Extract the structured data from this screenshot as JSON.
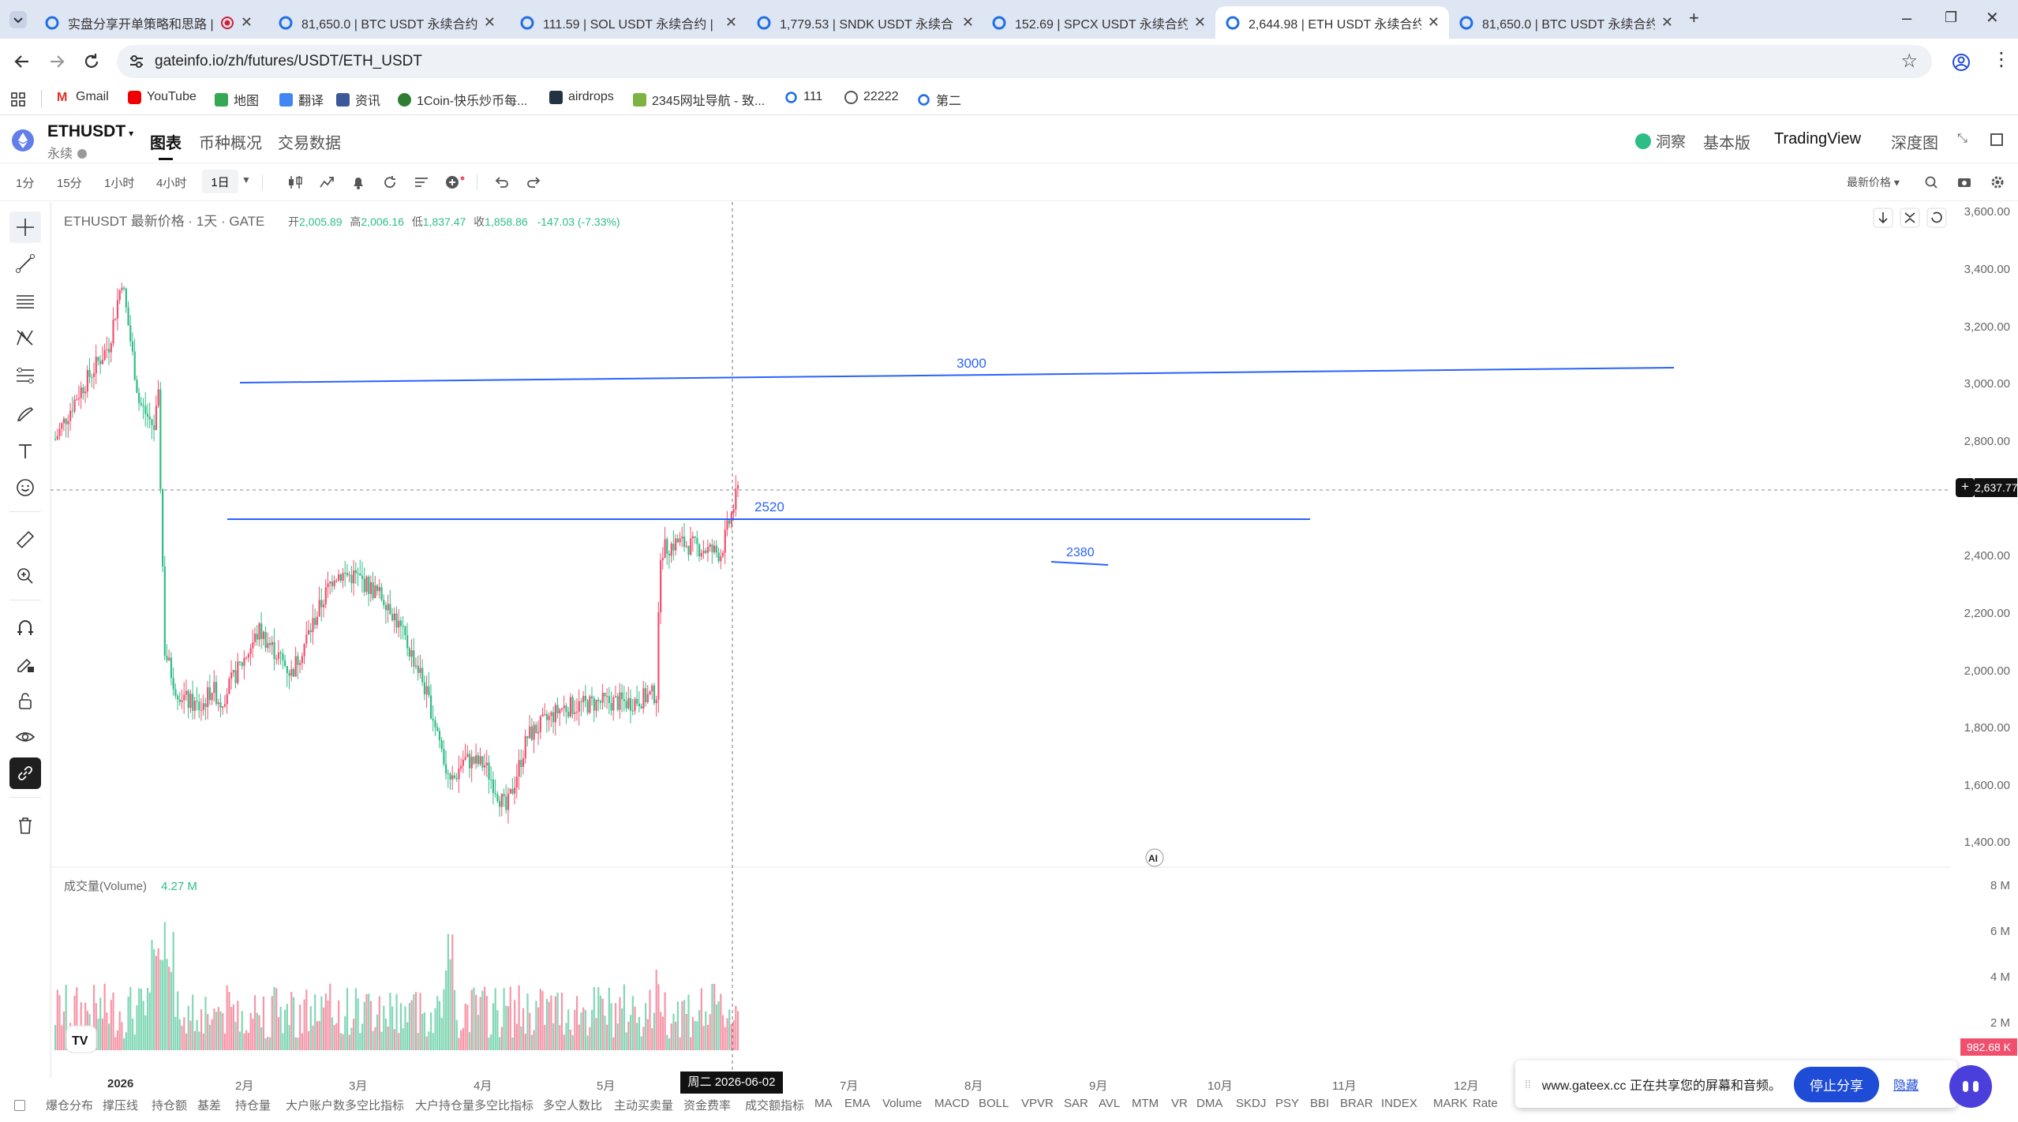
{
  "browser": {
    "tabs": [
      {
        "title": "实盘分享开单策略和思路 |",
        "active": false
      },
      {
        "title": "81,650.0 | BTC USDT 永续合约",
        "active": false
      },
      {
        "title": "111.59 | SOL USDT 永续合约 |",
        "active": false
      },
      {
        "title": "1,779.53 | SNDK USDT 永续合",
        "active": false
      },
      {
        "title": "152.69 | SPCX USDT 永续合约",
        "active": false
      },
      {
        "title": "2,644.98 | ETH USDT 永续合约",
        "active": true
      },
      {
        "title": "81,650.0 | BTC USDT 永续合约",
        "active": false
      }
    ],
    "url": "gateinfo.io/zh/futures/USDT/ETH_USDT",
    "bookmarks": [
      "Gmail",
      "YouTube",
      "地图",
      "翻译",
      "资讯",
      "1Coin-快乐炒币每...",
      "airdrops",
      "2345网址导航 - 致...",
      "111",
      "22222",
      "第二"
    ]
  },
  "app": {
    "symbol": "ETHUSDT",
    "contract_type": "永续",
    "tabs": [
      "图表",
      "币种概况",
      "交易数据"
    ],
    "right_links": [
      "洞察",
      "基本版",
      "TradingView",
      "深度图"
    ]
  },
  "toolbar": {
    "intervals": [
      "1分",
      "15分",
      "1小时",
      "4小时",
      "1日"
    ],
    "selected_interval": "1日",
    "price_type": "最新价格"
  },
  "chart": {
    "legend_title": "ETHUSDT 最新价格 · 1天 · GATE",
    "ohlc": {
      "open_label": "开",
      "open": "2,005.89",
      "high_label": "高",
      "high": "2,006.16",
      "low_label": "低",
      "low": "1,837.47",
      "close_label": "收",
      "close": "1,858.86",
      "change": "-147.03 (-7.33%)"
    },
    "price_axis": [
      "3,600.00",
      "3,400.00",
      "3,200.00",
      "3,000.00",
      "2,800.00",
      "2,400.00",
      "2,200.00",
      "2,000.00",
      "1,800.00",
      "1,600.00",
      "1,400.00"
    ],
    "volume_axis": [
      "8 M",
      "6 M",
      "4 M",
      "2 M"
    ],
    "time_axis": [
      "2026",
      "2月",
      "3月",
      "4月",
      "5月",
      "7月",
      "8月",
      "9月",
      "10月",
      "11月",
      "12月"
    ],
    "crosshair_date": "周二 2026-06-02",
    "current_price": "2,637.77",
    "current_volume": "982.68 K",
    "line_labels": [
      "3000",
      "2520",
      "2380"
    ],
    "volume_label": "成交量(Volume)",
    "volume_value": "4.27 M",
    "ai_badge": "AI"
  },
  "indicators": [
    "爆仓分布",
    "撑压线",
    "持仓额",
    "基差",
    "持仓量",
    "大户账户数多空比指标",
    "大户持仓量多空比指标",
    "多空人数比",
    "主动买卖量",
    "资金费率",
    "成交额指标",
    "MA",
    "EMA",
    "Volume",
    "MACD",
    "BOLL",
    "VPVR",
    "SAR",
    "AVL",
    "MTM",
    "VR",
    "DMA",
    "SKDJ",
    "PSY",
    "BBI",
    "BRAR",
    "INDEX",
    "MARK",
    "Rate"
  ],
  "share_bar": {
    "message": "www.gateex.cc 正在共享您的屏幕和音频。",
    "stop_label": "停止分享",
    "hide_label": "隐藏"
  },
  "colors": {
    "up": "#f0506e",
    "down": "#2ebd85",
    "line": "#2962ff",
    "accent": "#1f4cd6"
  }
}
